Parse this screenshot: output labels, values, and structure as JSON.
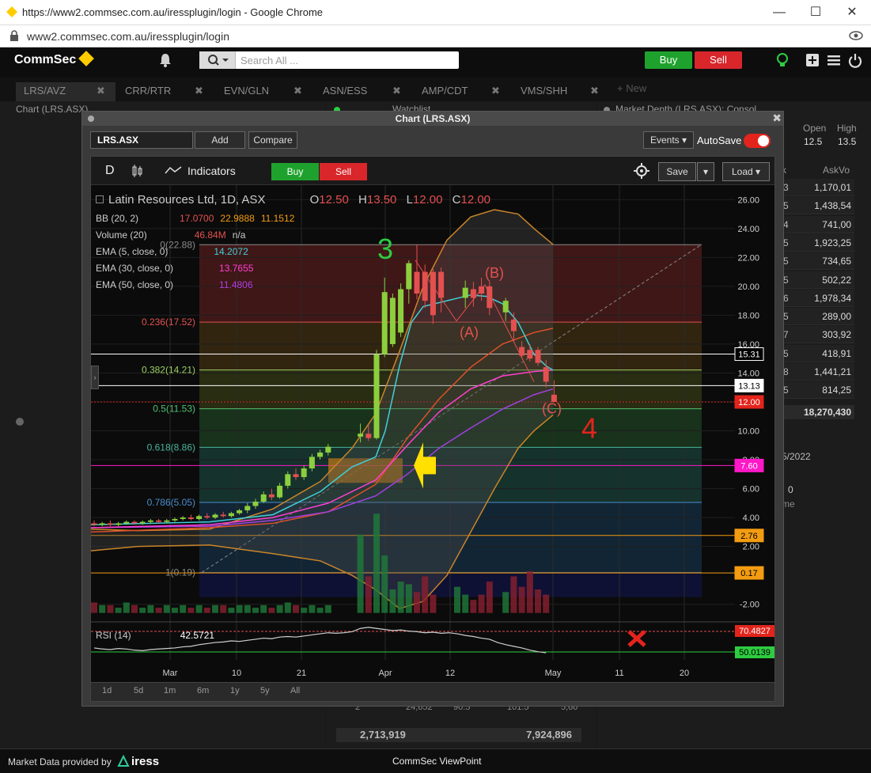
{
  "browser": {
    "title": "https://www2.commsec.com.au/iressplugin/login - Google Chrome",
    "url": "www2.commsec.com.au/iressplugin/login"
  },
  "header": {
    "logo": "CommSec",
    "search_placeholder": "Search All ...",
    "buy": "Buy",
    "sell": "Sell"
  },
  "tabs": [
    {
      "label": "LRS/AVZ"
    },
    {
      "label": "CRR/RTR"
    },
    {
      "label": "EVN/GLN"
    },
    {
      "label": "ASN/ESS"
    },
    {
      "label": "AMP/CDT"
    },
    {
      "label": "VMS/SHH"
    }
  ],
  "new_tab": "+ New",
  "background": {
    "chart_label": "Chart (LRS.ASX)",
    "watchlist_label": "Watchlist",
    "depth_label": "Market Depth (LRS.ASX): Consol...",
    "open_label": "Open",
    "high_label": "High",
    "open_value": "12.5",
    "high_value": "13.5",
    "k_label": "k",
    "askvol_label": "AskVo",
    "depth_rows": [
      {
        "n": "3",
        "v": "1,170,01"
      },
      {
        "n": "5",
        "v": "1,438,54"
      },
      {
        "n": "4",
        "v": "741,00"
      },
      {
        "n": "5",
        "v": "1,923,25"
      },
      {
        "n": "5",
        "v": "734,65"
      },
      {
        "n": "5",
        "v": "502,22"
      },
      {
        "n": "6",
        "v": "1,978,34"
      },
      {
        "n": "5",
        "v": "289,00"
      },
      {
        "n": "7",
        "v": "303,92"
      },
      {
        "n": "5",
        "v": "418,91"
      },
      {
        "n": "8",
        "v": "1,441,21"
      },
      {
        "n": "5",
        "v": "814,25"
      }
    ],
    "depth_total": "18,270,430",
    "date_field": "5/2022",
    "zero": "0",
    "me": "me",
    "bottom_row": {
      "a": "2",
      "b": "24,652",
      "c": "90.5",
      "d": "101.5",
      "e": "5,60"
    },
    "totals": {
      "left": "2,713,919",
      "right": "7,924,896"
    }
  },
  "chart_window": {
    "title": "Chart (LRS.ASX)",
    "symbol": "LRS.ASX",
    "add": "Add",
    "compare": "Compare",
    "events": "Events",
    "autosave": "AutoSave",
    "toolbar": {
      "d": "D",
      "indicators": "Indicators",
      "buy": "Buy",
      "sell": "Sell",
      "save": "Save",
      "load": "Load"
    },
    "legend": {
      "name": "Latin Resources Ltd, 1D, ASX",
      "o": "O",
      "o_val": "12.50",
      "h": "H",
      "h_val": "13.50",
      "l": "L",
      "l_val": "12.00",
      "c": "C",
      "c_val": "12.00",
      "bb": "BB (20, 2)",
      "bb1": "17.0700",
      "bb2": "22.9888",
      "bb3": "11.1512",
      "vol": "Volume (20)",
      "vol_val": "46.84M",
      "vol_na": "n/a",
      "ema5": "EMA (5, close, 0)",
      "ema5_val": "14.2072",
      "ema30": "EMA (30, close, 0)",
      "ema30_val": "13.7655",
      "ema50": "EMA (50, close, 0)",
      "ema50_val": "11.4806"
    },
    "rsi": {
      "label": "RSI (14)",
      "value": "42.5721",
      "upper": "70.4827",
      "lower": "50.0139"
    },
    "periods": [
      "1d",
      "5d",
      "1m",
      "6m",
      "1y",
      "5y",
      "All"
    ]
  },
  "chart_data": {
    "type": "candlestick",
    "title": "Latin Resources Ltd, 1D, ASX",
    "y_ticks": [
      "26.00",
      "24.00",
      "22.00",
      "20.00",
      "18.00",
      "16.00",
      "14.00",
      "12.00",
      "10.00",
      "8.00",
      "6.00",
      "4.00",
      "2.00",
      "-2.00"
    ],
    "y_range": [
      -3,
      27
    ],
    "x_ticks": [
      "Mar",
      "10",
      "21",
      "Apr",
      "12",
      "May",
      "11",
      "20"
    ],
    "fib_levels": [
      {
        "label": "0(22.88)",
        "value": 22.88,
        "color": "#8a8a8a"
      },
      {
        "label": "0.236(17.52)",
        "value": 17.52,
        "color": "#e35050"
      },
      {
        "label": "0.382(14.21)",
        "value": 14.21,
        "color": "#9ad060"
      },
      {
        "label": "0.5(11.53)",
        "value": 11.53,
        "color": "#4fc070"
      },
      {
        "label": "0.618(8.86)",
        "value": 8.86,
        "color": "#49b49a"
      },
      {
        "label": "0.786(5.05)",
        "value": 5.05,
        "color": "#4a8fd0"
      },
      {
        "label": "1(0.19)",
        "value": 0.19,
        "color": "#888888"
      }
    ],
    "price_labels": [
      {
        "label": "15.31",
        "value": 15.31,
        "bg": "#000000",
        "fg": "#ffffff"
      },
      {
        "label": "13.13",
        "value": 13.13,
        "bg": "#ffffff",
        "fg": "#000000"
      },
      {
        "label": "12.00",
        "value": 12.0,
        "bg": "#e3241c",
        "fg": "#ffffff"
      },
      {
        "label": "7.60",
        "value": 7.6,
        "bg": "#ff18c8",
        "fg": "#ffffff"
      },
      {
        "label": "2.76",
        "value": 2.76,
        "bg": "#f39c12",
        "fg": "#000000"
      },
      {
        "label": "0.17",
        "value": 0.17,
        "bg": "#f39c12",
        "fg": "#000000"
      }
    ],
    "annotations": [
      {
        "text": "3",
        "color": "#2ecc40"
      },
      {
        "text": "(B)",
        "color": "#e35050"
      },
      {
        "text": "(A)",
        "color": "#e35050"
      },
      {
        "text": "(C)",
        "color": "#e35050"
      },
      {
        "text": "4",
        "color": "#e3241c"
      }
    ],
    "candles": [
      {
        "d": 0,
        "o": 3.6,
        "h": 3.8,
        "l": 3.4,
        "c": 3.5
      },
      {
        "d": 1,
        "o": 3.5,
        "h": 3.7,
        "l": 3.4,
        "c": 3.6
      },
      {
        "d": 2,
        "o": 3.6,
        "h": 3.8,
        "l": 3.4,
        "c": 3.5
      },
      {
        "d": 3,
        "o": 3.5,
        "h": 3.7,
        "l": 3.4,
        "c": 3.6
      },
      {
        "d": 4,
        "o": 3.6,
        "h": 3.8,
        "l": 3.5,
        "c": 3.7
      },
      {
        "d": 5,
        "o": 3.7,
        "h": 3.8,
        "l": 3.5,
        "c": 3.6
      },
      {
        "d": 6,
        "o": 3.6,
        "h": 3.8,
        "l": 3.5,
        "c": 3.7
      },
      {
        "d": 7,
        "o": 3.7,
        "h": 3.9,
        "l": 3.6,
        "c": 3.8
      },
      {
        "d": 8,
        "o": 3.8,
        "h": 3.9,
        "l": 3.6,
        "c": 3.7
      },
      {
        "d": 9,
        "o": 3.7,
        "h": 3.9,
        "l": 3.6,
        "c": 3.8
      },
      {
        "d": 10,
        "o": 3.8,
        "h": 4.0,
        "l": 3.7,
        "c": 3.9
      },
      {
        "d": 11,
        "o": 3.9,
        "h": 4.1,
        "l": 3.8,
        "c": 4.0
      },
      {
        "d": 12,
        "o": 4.0,
        "h": 4.2,
        "l": 3.8,
        "c": 3.9
      },
      {
        "d": 13,
        "o": 3.9,
        "h": 4.2,
        "l": 3.8,
        "c": 4.1
      },
      {
        "d": 14,
        "o": 4.1,
        "h": 4.3,
        "l": 3.9,
        "c": 4.0
      },
      {
        "d": 15,
        "o": 4.0,
        "h": 4.3,
        "l": 3.9,
        "c": 4.2
      },
      {
        "d": 16,
        "o": 4.2,
        "h": 4.4,
        "l": 4.0,
        "c": 4.1
      },
      {
        "d": 17,
        "o": 4.1,
        "h": 4.4,
        "l": 4.0,
        "c": 4.3
      },
      {
        "d": 18,
        "o": 4.3,
        "h": 4.6,
        "l": 4.2,
        "c": 4.5
      },
      {
        "d": 19,
        "o": 4.5,
        "h": 5.0,
        "l": 4.3,
        "c": 4.8
      },
      {
        "d": 20,
        "o": 4.8,
        "h": 5.3,
        "l": 4.6,
        "c": 5.1
      },
      {
        "d": 21,
        "o": 5.1,
        "h": 5.8,
        "l": 5.0,
        "c": 5.6
      },
      {
        "d": 22,
        "o": 5.6,
        "h": 6.0,
        "l": 5.2,
        "c": 5.4
      },
      {
        "d": 23,
        "o": 5.4,
        "h": 6.4,
        "l": 5.3,
        "c": 6.2
      },
      {
        "d": 24,
        "o": 6.2,
        "h": 7.2,
        "l": 6.0,
        "c": 7.0
      },
      {
        "d": 25,
        "o": 7.0,
        "h": 7.4,
        "l": 6.6,
        "c": 6.8
      },
      {
        "d": 26,
        "o": 6.8,
        "h": 7.6,
        "l": 6.6,
        "c": 7.4
      },
      {
        "d": 27,
        "o": 7.4,
        "h": 8.4,
        "l": 7.2,
        "c": 8.2
      },
      {
        "d": 28,
        "o": 8.2,
        "h": 8.7,
        "l": 8.0,
        "c": 8.5
      },
      {
        "d": 29,
        "o": 8.5,
        "h": 9.1,
        "l": 8.3,
        "c": 8.9
      },
      {
        "d": 33,
        "o": 9.6,
        "h": 10.5,
        "l": 9.2,
        "c": 9.8
      },
      {
        "d": 34,
        "o": 9.8,
        "h": 10.4,
        "l": 9.3,
        "c": 9.5
      },
      {
        "d": 35,
        "o": 9.5,
        "h": 15.6,
        "l": 9.4,
        "c": 15.3
      },
      {
        "d": 36,
        "o": 15.3,
        "h": 20.6,
        "l": 15.1,
        "c": 19.6
      },
      {
        "d": 37,
        "o": 16.0,
        "h": 19.5,
        "l": 15.8,
        "c": 19.2
      },
      {
        "d": 38,
        "o": 16.8,
        "h": 20.2,
        "l": 16.5,
        "c": 19.8
      },
      {
        "d": 39,
        "o": 19.8,
        "h": 21.8,
        "l": 18.8,
        "c": 21.6
      },
      {
        "d": 40,
        "o": 21.0,
        "h": 22.9,
        "l": 19.1,
        "c": 19.5
      },
      {
        "d": 41,
        "o": 21.0,
        "h": 21.5,
        "l": 18.5,
        "c": 19.0
      },
      {
        "d": 42,
        "o": 21.0,
        "h": 21.2,
        "l": 17.4,
        "c": 18.0
      },
      {
        "d": 43,
        "o": 21.0,
        "h": 21.3,
        "l": 18.2,
        "c": 19.2
      },
      {
        "d": 46,
        "o": 19.2,
        "h": 20.4,
        "l": 18.5,
        "c": 19.9
      },
      {
        "d": 47,
        "o": 19.8,
        "h": 20.3,
        "l": 18.6,
        "c": 19.2
      },
      {
        "d": 48,
        "o": 20.0,
        "h": 20.6,
        "l": 19.0,
        "c": 19.5
      },
      {
        "d": 49,
        "o": 20.0,
        "h": 20.4,
        "l": 18.0,
        "c": 18.5
      },
      {
        "d": 51,
        "o": 18.2,
        "h": 19.2,
        "l": 17.6,
        "c": 19.0
      },
      {
        "d": 52,
        "o": 17.7,
        "h": 18.2,
        "l": 16.2,
        "c": 16.9
      },
      {
        "d": 53,
        "o": 15.8,
        "h": 16.2,
        "l": 15.0,
        "c": 15.2
      },
      {
        "d": 54,
        "o": 15.6,
        "h": 16.0,
        "l": 14.8,
        "c": 15.0
      },
      {
        "d": 55,
        "o": 15.6,
        "h": 15.8,
        "l": 14.5,
        "c": 14.7
      },
      {
        "d": 56,
        "o": 14.4,
        "h": 14.9,
        "l": 13.0,
        "c": 13.4
      },
      {
        "d": 57,
        "o": 12.5,
        "h": 13.5,
        "l": 12.0,
        "c": 12.0
      }
    ],
    "volume": [
      4,
      3,
      3,
      2,
      4,
      3,
      2,
      3,
      2,
      3,
      2,
      3,
      2,
      3,
      2,
      3,
      3,
      2,
      3,
      3,
      2,
      3,
      2,
      3,
      4,
      3,
      2,
      3,
      2,
      3,
      0,
      0,
      0,
      30,
      14,
      38,
      22,
      9,
      12,
      11,
      8,
      14,
      7,
      0,
      0,
      10,
      7,
      5,
      7,
      12,
      0,
      8,
      14,
      10,
      16,
      9,
      7
    ],
    "rsi": [
      52,
      50,
      49,
      51,
      50,
      48,
      47,
      49,
      50,
      51,
      52,
      54,
      55,
      58,
      60,
      62,
      63,
      65,
      64,
      66,
      68,
      70,
      69,
      72,
      73,
      72,
      74,
      76,
      78,
      80,
      79,
      80,
      82,
      88,
      90,
      88,
      86,
      84,
      85,
      83,
      82,
      80,
      81,
      79,
      80,
      78,
      75,
      73,
      70,
      68,
      62,
      58,
      55,
      52,
      48,
      45,
      43
    ]
  },
  "footer": {
    "provided": "Market Data provided by",
    "iress": "iress",
    "viewpoint": "CommSec ViewPoint"
  }
}
